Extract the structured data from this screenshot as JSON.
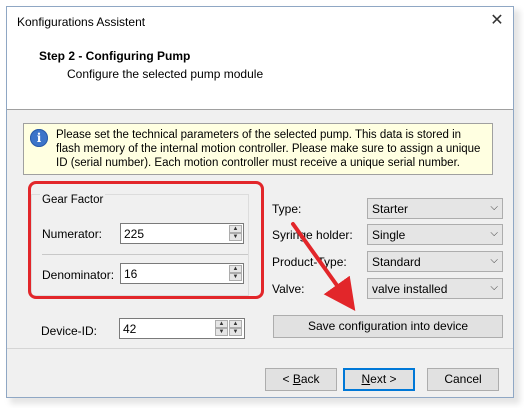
{
  "window": {
    "title": "Konfigurations Assistent",
    "close_glyph": "✕"
  },
  "header": {
    "step_title": "Step 2 - Configuring Pump",
    "step_subtitle": "Configure the selected pump module"
  },
  "info": {
    "icon_glyph": "i",
    "icon_name": "info-icon",
    "text": "Please set the technical parameters of the selected pump. This data is stored in flash memory of the internal motion controller. Please make sure to assign a unique ID (serial number). Each motion controller must receive a unique serial number."
  },
  "gear_factor": {
    "legend": "Gear Factor",
    "numerator_label": "Numerator:",
    "numerator_value": "225",
    "denominator_label": "Denominator:",
    "denominator_value": "16"
  },
  "device": {
    "label": "Device-ID:",
    "value": "42"
  },
  "params": {
    "type_label": "Type:",
    "type_value": "Starter",
    "syringe_label": "Syringe holder:",
    "syringe_value": "Single",
    "product_label": "Product-Type:",
    "product_value": "Standard",
    "valve_label": "Valve:",
    "valve_value": "valve installed"
  },
  "buttons": {
    "save_config": "Save configuration into device",
    "back_prefix": "< ",
    "back_mnemonic": "B",
    "back_rest": "ack",
    "next_mnemonic": "N",
    "next_rest": "ext >",
    "cancel": "Cancel"
  },
  "icons": {
    "spin_up": "▲",
    "spin_down": "▼",
    "chevron_down": "⌵"
  },
  "colors": {
    "annotation": "#e2262a",
    "info_background": "#ffffe1",
    "dialog_background": "#f0f0f0",
    "default_button_border": "#0078d7"
  }
}
